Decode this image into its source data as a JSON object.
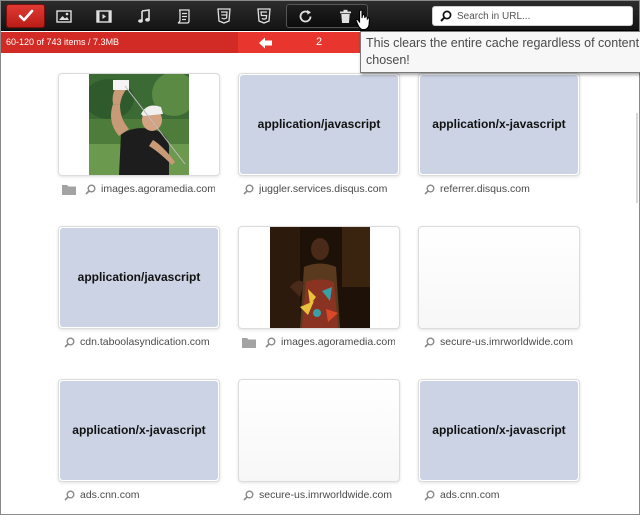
{
  "toolbar": {
    "buttons": [
      {
        "icon": "checkmark-icon"
      },
      {
        "icon": "image-icon"
      },
      {
        "icon": "video-icon"
      },
      {
        "icon": "music-icon"
      },
      {
        "icon": "script-icon"
      },
      {
        "icon": "css3-icon"
      },
      {
        "icon": "html5-icon"
      },
      {
        "icon": "refresh-icon"
      },
      {
        "icon": "trash-icon"
      }
    ],
    "search_placeholder": "Search in URL..."
  },
  "status": {
    "count_text": "60-120 of 743 items / 7.3MB",
    "page": "2",
    "accent": "#d22a24"
  },
  "tooltip": {
    "text": "This clears the entire cache regardless of content chosen!"
  },
  "grid": {
    "items": [
      {
        "type": "image",
        "caption": "images.agoramedia.com"
      },
      {
        "type": "placeholder",
        "label": "application/javascript",
        "caption": "juggler.services.disqus.com"
      },
      {
        "type": "placeholder",
        "label": "application/x-javascript",
        "caption": "referrer.disqus.com"
      },
      {
        "type": "placeholder",
        "label": "application/javascript",
        "caption": "cdn.taboolasyndication.com"
      },
      {
        "type": "image",
        "caption": "images.agoramedia.com"
      },
      {
        "type": "blank",
        "caption": "secure-us.imrworldwide.com"
      },
      {
        "type": "placeholder",
        "label": "application/x-javascript",
        "caption": "ads.cnn.com"
      },
      {
        "type": "blank",
        "caption": "secure-us.imrworldwide.com"
      },
      {
        "type": "placeholder",
        "label": "application/x-javascript",
        "caption": "ads.cnn.com"
      }
    ]
  }
}
